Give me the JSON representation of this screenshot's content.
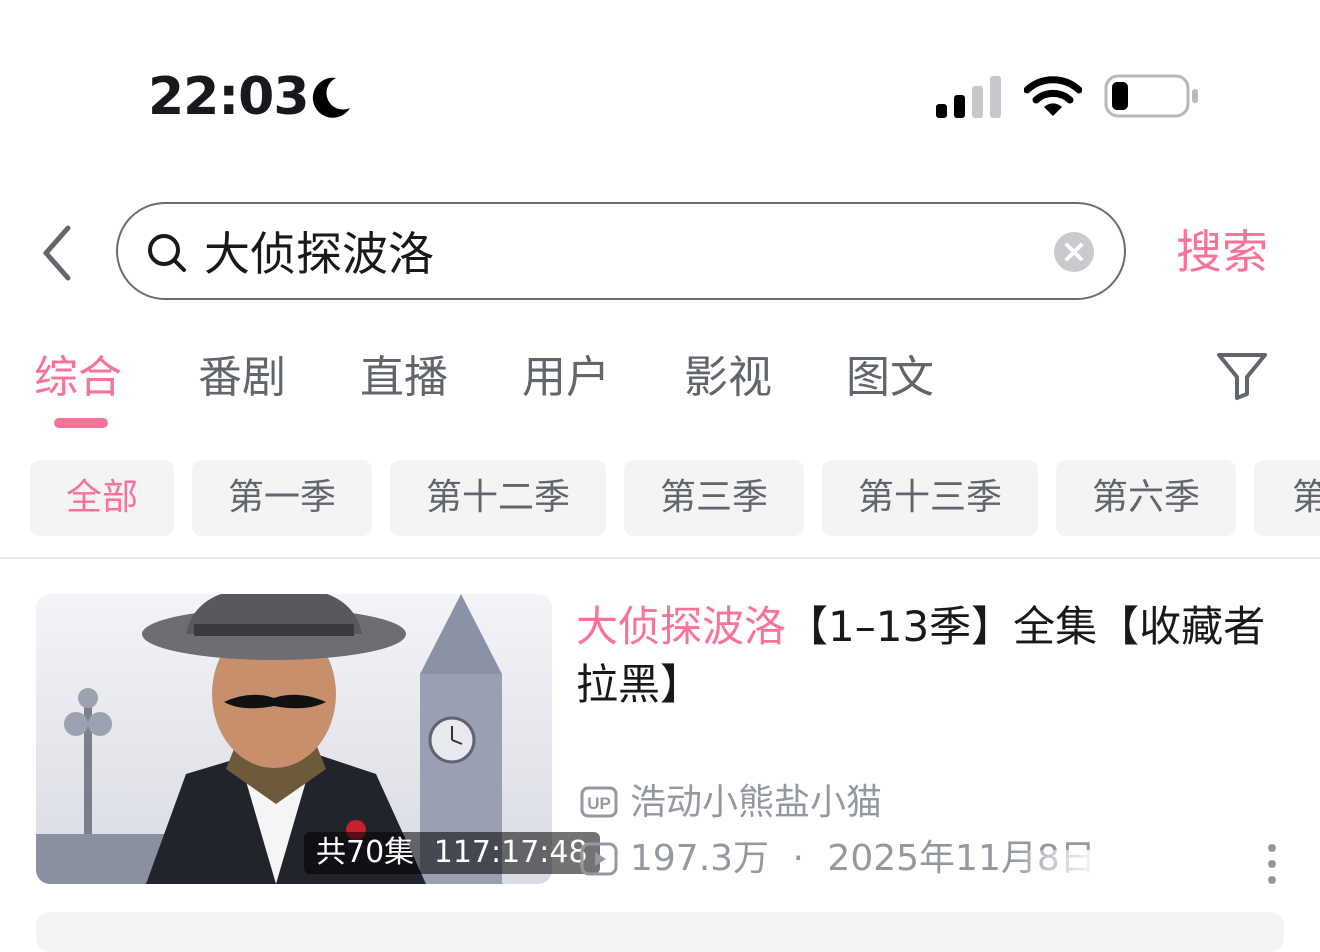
{
  "status_bar": {
    "time": "22:03",
    "focus_icon": "moon-icon",
    "signal_icon": "cellular-signal-icon",
    "wifi_icon": "wifi-icon",
    "battery_icon": "battery-low-icon"
  },
  "search": {
    "query": "大侦探波洛",
    "search_button": "搜索",
    "back_icon": "chevron-left-icon",
    "search_icon": "search-icon",
    "clear_icon": "clear-icon"
  },
  "tabs": [
    {
      "label": "综合",
      "active": true
    },
    {
      "label": "番剧"
    },
    {
      "label": "直播"
    },
    {
      "label": "用户"
    },
    {
      "label": "影视"
    },
    {
      "label": "图文"
    }
  ],
  "filter_icon": "filter-icon",
  "chips": [
    {
      "label": "全部",
      "active": true
    },
    {
      "label": "第一季"
    },
    {
      "label": "第十二季"
    },
    {
      "label": "第三季"
    },
    {
      "label": "第十三季"
    },
    {
      "label": "第六季"
    },
    {
      "label": "第"
    }
  ],
  "result": {
    "title_highlight": "大侦探波洛",
    "title_rest": "【1–13季】全集【收藏者拉黑】",
    "episode_count": "共70集",
    "duration": "117:17:48",
    "uploader": "浩动小熊盐小猫",
    "views": "197.3万",
    "separator": "·",
    "date": "2025年11月8日",
    "up_icon": "up-badge-icon",
    "play_icon": "play-count-icon",
    "more_icon": "more-vertical-icon"
  },
  "colors": {
    "accent": "#fb7299",
    "text": "#18191c",
    "secondary": "#61666d",
    "meta": "#9499a0",
    "chip_bg": "#f4f4f5"
  }
}
